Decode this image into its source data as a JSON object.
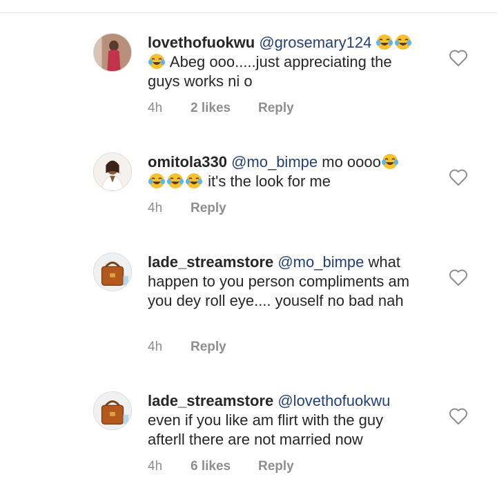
{
  "comments": [
    {
      "username": "lovethofuokwu",
      "mention": "@grosemary124",
      "text_after_emojis": " Abeg ooo.....just appreciating the guys works ni o",
      "time": "4h",
      "likes": "2 likes",
      "reply": "Reply"
    },
    {
      "username": "omitola330",
      "mention": "@mo_bimpe",
      "text_before_emoji": " mo oooo",
      "text_after_emojis": " it's the look for me",
      "time": "4h",
      "likes": "",
      "reply": "Reply"
    },
    {
      "username": "lade_streamstore",
      "mention": "@mo_bimpe",
      "text": " what happen to you person compliments am you dey roll eye.... youself no bad nah",
      "time": "4h",
      "likes": "",
      "reply": "Reply"
    },
    {
      "username": "lade_streamstore",
      "mention": "@lovethofuokwu",
      "text": " even if you like am flirt with the guy afterll there are not married now",
      "time": "4h",
      "likes": "6 likes",
      "reply": "Reply"
    }
  ],
  "icons": {
    "like": "heart-outline-icon",
    "emoji": "tears-of-joy-emoji"
  },
  "colors": {
    "mention": "#223f7b",
    "meta": "#8e8e8e",
    "text": "#262626"
  }
}
